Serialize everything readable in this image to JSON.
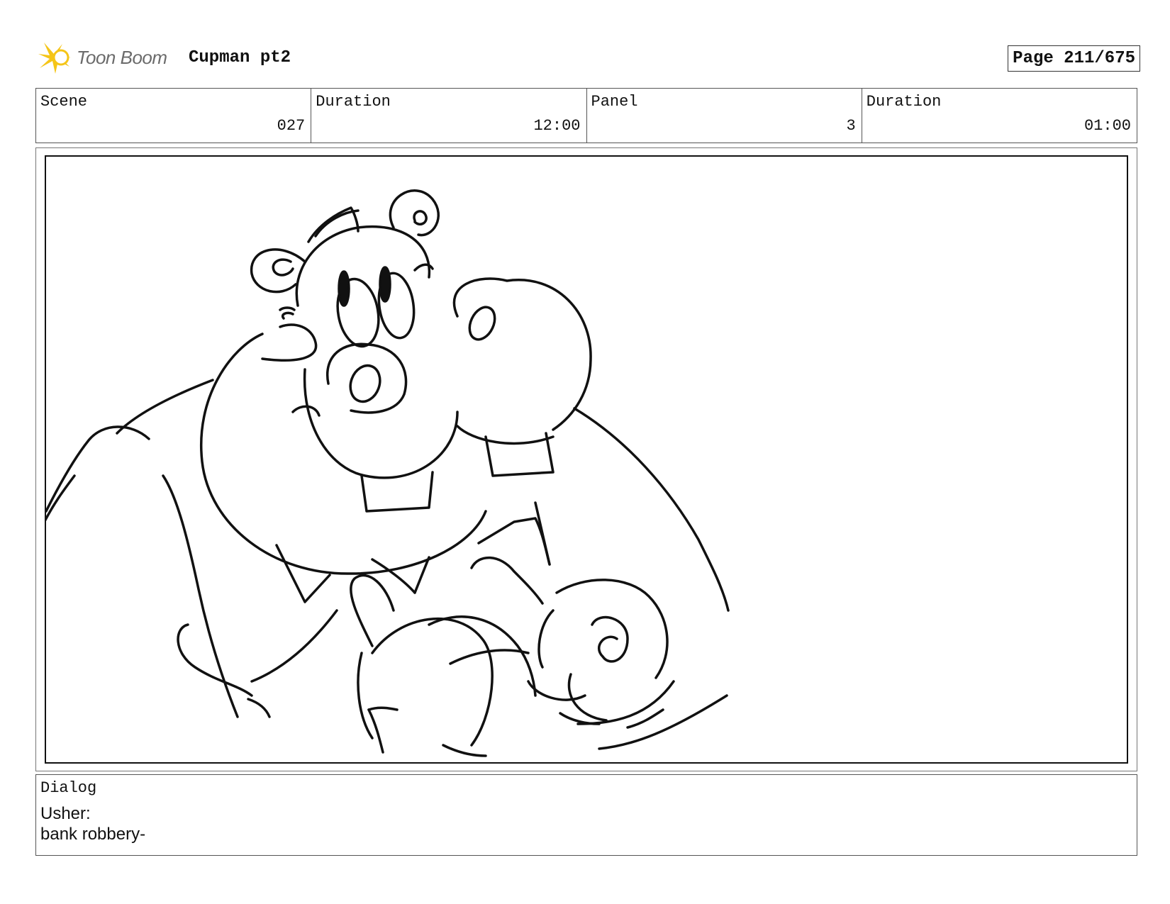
{
  "header": {
    "logo_text": "Toon Boom",
    "project_title": "Cupman pt2",
    "page_label": "Page 211/675"
  },
  "info": {
    "scene_label": "Scene",
    "scene_value": "027",
    "scene_duration_label": "Duration",
    "scene_duration_value": "12:00",
    "panel_label": "Panel",
    "panel_value": "3",
    "panel_duration_label": "Duration",
    "panel_duration_value": "01:00"
  },
  "dialog": {
    "label": "Dialog",
    "lines": [
      "Usher:",
      "bank robbery-"
    ]
  },
  "colors": {
    "logo_accent": "#f5c518",
    "ink": "#111111"
  },
  "icons": {
    "logo": "toon-boom-star-icon"
  }
}
